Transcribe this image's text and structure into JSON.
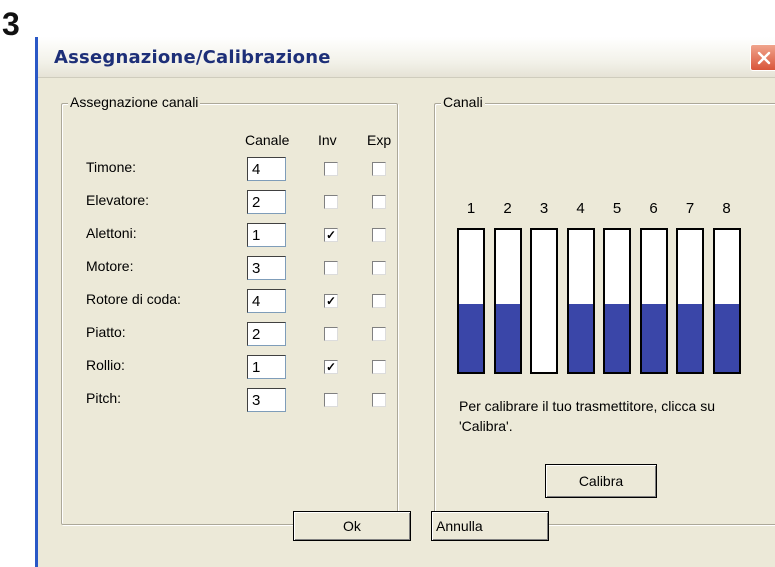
{
  "step_number": "3",
  "window": {
    "title": "Assegnazione/Calibrazione"
  },
  "assignment": {
    "group_title": "Assegnazione canali",
    "headers": {
      "canale": "Canale",
      "inv": "Inv",
      "exp": "Exp"
    },
    "rows": [
      {
        "label": "Timone:",
        "channel": "4",
        "inv": false,
        "exp": false
      },
      {
        "label": "Elevatore:",
        "channel": "2",
        "inv": false,
        "exp": false
      },
      {
        "label": "Alettoni:",
        "channel": "1",
        "inv": true,
        "exp": false
      },
      {
        "label": "Motore:",
        "channel": "3",
        "inv": false,
        "exp": false
      },
      {
        "label": "Rotore di coda:",
        "channel": "4",
        "inv": true,
        "exp": false
      },
      {
        "label": "Piatto:",
        "channel": "2",
        "inv": false,
        "exp": false
      },
      {
        "label": "Rollio:",
        "channel": "1",
        "inv": true,
        "exp": false
      },
      {
        "label": "Pitch:",
        "channel": "3",
        "inv": false,
        "exp": false
      }
    ],
    "check_glyph": "✓"
  },
  "channels": {
    "group_title": "Canali",
    "items": [
      {
        "number": "1",
        "level": 0.48
      },
      {
        "number": "2",
        "level": 0.48
      },
      {
        "number": "3",
        "level": 0
      },
      {
        "number": "4",
        "level": 0.48
      },
      {
        "number": "5",
        "level": 0.48
      },
      {
        "number": "6",
        "level": 0.48
      },
      {
        "number": "7",
        "level": 0.48
      },
      {
        "number": "8",
        "level": 0.48
      }
    ],
    "fill_color": "#3a46a8",
    "info_text": "Per calibrare il tuo trasmettitore, clicca su 'Calibra'.",
    "calibrate_label": "Calibra"
  },
  "footer": {
    "ok_label": "Ok",
    "cancel_label": "Annulla"
  },
  "icons": {
    "close": "close-icon"
  }
}
